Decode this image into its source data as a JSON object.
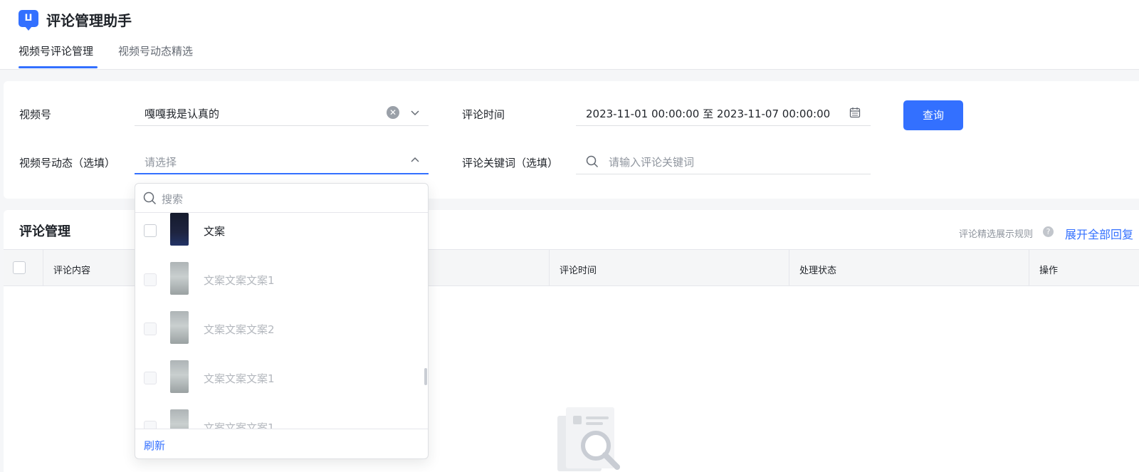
{
  "app": {
    "title": "评论管理助手",
    "logo_glyph": "ⵡ",
    "accent": "#3370ff"
  },
  "tabs": [
    {
      "label": "视频号评论管理",
      "active": true
    },
    {
      "label": "视频号动态精选",
      "active": false
    }
  ],
  "filters": {
    "channel": {
      "label": "视频号",
      "value": "嘎嘎我是认真的"
    },
    "comment_time": {
      "label": "评论时间",
      "value": "2023-11-01 00:00:00 至 2023-11-07 00:00:00"
    },
    "query_button": "查询",
    "post": {
      "label": "视频号动态（选填）",
      "placeholder": "请选择"
    },
    "keyword": {
      "label": "评论关键词（选填）",
      "placeholder": "请输入评论关键词"
    }
  },
  "comments": {
    "title": "评论管理",
    "rule_link": "评论精选展示规则",
    "expand_all": "展开全部回复",
    "columns": [
      "评论内容",
      "评论时间",
      "处理状态",
      "操作"
    ]
  },
  "dropdown": {
    "search_placeholder": "搜索",
    "items": [
      {
        "label": "文案",
        "disabled": false,
        "thumb": "dark"
      },
      {
        "label": "文案文案文案1",
        "disabled": true,
        "thumb": "grey"
      },
      {
        "label": "文案文案文案2",
        "disabled": true,
        "thumb": "grey"
      },
      {
        "label": "文案文案文案1",
        "disabled": true,
        "thumb": "grey"
      },
      {
        "label": "文案文案文案1",
        "disabled": true,
        "thumb": "grey"
      }
    ],
    "refresh": "刷新"
  }
}
